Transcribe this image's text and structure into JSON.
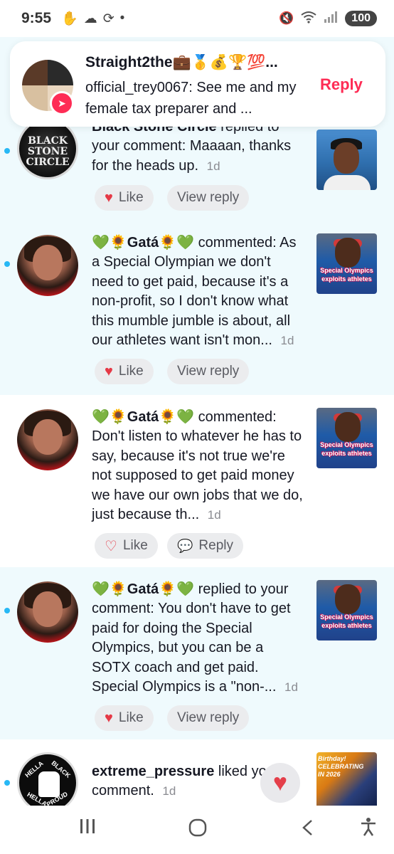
{
  "status_bar": {
    "time": "9:55",
    "icons": [
      "wave-icon",
      "cloud-icon",
      "sync-icon",
      "dot-icon"
    ],
    "right_icons": [
      "mute-icon",
      "wifi-icon",
      "signal-icon"
    ],
    "battery": "100"
  },
  "notification": {
    "title": "Straight2the💼🥇💰🏆💯...",
    "body": "official_trey0067: See me and my female tax preparer and ...",
    "reply_label": "Reply"
  },
  "activity": [
    {
      "name": "Black Stone Circle",
      "action": "replied to your comment: Maaaan, thanks for the heads up.",
      "time": "1d",
      "avatar_text": "BLACK STONE CIRCLE",
      "buttons": {
        "like": "Like",
        "secondary": "View reply"
      }
    },
    {
      "name": "💚🌻Gatá🌻💚",
      "action": "commented: As a Special Olympian we don't need to get paid, because it's a non-profit, so I don't know what this mumble jumble is about, all our athletes want isn't mon...",
      "time": "1d",
      "thumb_caption": "Special Olympics exploits athletes",
      "buttons": {
        "like": "Like",
        "secondary": "View reply"
      }
    },
    {
      "name": "💚🌻Gatá🌻💚",
      "action": "commented: Don't listen to whatever he has to say, because it's not true we're not supposed to get paid money we have our own jobs that we do, just because th...",
      "time": "1d",
      "thumb_caption": "Special Olympics exploits athletes",
      "buttons": {
        "like": "Like",
        "secondary": "Reply"
      }
    },
    {
      "name": "💚🌻Gatá🌻💚",
      "action": "replied to your comment: You don't have to get paid for doing the Special Olympics, but you can be a SOTX coach and get paid. Special Olympics is a \"non-...",
      "time": "1d",
      "thumb_caption": "Special Olympics exploits athletes",
      "buttons": {
        "like": "Like",
        "secondary": "View reply"
      }
    },
    {
      "name": "extreme_pressure",
      "action": "liked your comment.",
      "time": "1d",
      "avatar_text": [
        "HELLA",
        "BLACK",
        "HELLA",
        "PROUD"
      ],
      "thumb_caption": "Birthday! CELEBRATING IN 2026"
    }
  ],
  "nav": [
    "recents-icon",
    "home-icon",
    "back-icon",
    "accessibility-icon"
  ]
}
